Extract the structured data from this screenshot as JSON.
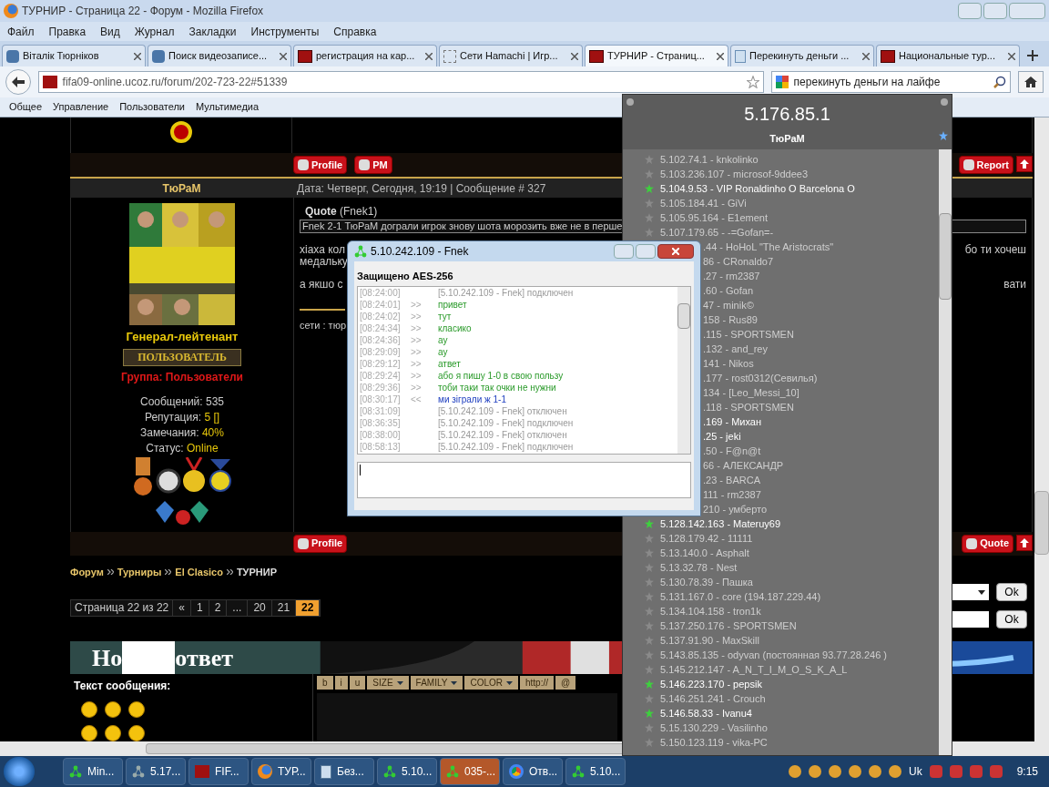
{
  "window": {
    "title": "ТУРНИР - Страница 22 - Форум - Mozilla Firefox"
  },
  "menu": [
    "Файл",
    "Правка",
    "Вид",
    "Журнал",
    "Закладки",
    "Инструменты",
    "Справка"
  ],
  "tabs": [
    {
      "label": "Віталік Тюрніков",
      "selected": false
    },
    {
      "label": "Поиск видеозаписе...",
      "selected": false
    },
    {
      "label": "регистрация на кар...",
      "selected": false
    },
    {
      "label": "Сети Hamachi | Игр...",
      "selected": false
    },
    {
      "label": "ТУРНИР - Страниц...",
      "selected": true
    },
    {
      "label": "Перекинуть деньги ...",
      "selected": false
    },
    {
      "label": "Национальные тур...",
      "selected": false
    }
  ],
  "address": {
    "value": "fifa09-online.ucoz.ru/forum/202-723-22#51339"
  },
  "search": {
    "value": "перекинуть деньги на лайфе"
  },
  "bookmarks": [
    "Общее",
    "Управление",
    "Пользователи",
    "Мультимедиа"
  ],
  "post": {
    "author": "ТюРаМ",
    "header": "Дата: Четверг, Сегодня, 19:19 | Сообщение # 327",
    "rank": "Генерал-лейтенант",
    "badge": "ПОЛЬЗОВАТЕЛЬ",
    "group": "Группа: Пользователи",
    "stats": [
      {
        "label": "Сообщений:",
        "value": "535",
        "kind": "plain"
      },
      {
        "label": "Репутация:",
        "value": "5 []",
        "kind": "gold"
      },
      {
        "label": "Замечания:",
        "value": "40%",
        "kind": "gold"
      },
      {
        "label": "Статус:",
        "value": "Online",
        "kind": "gold"
      }
    ],
    "quote_title": "Quote",
    "quote_author": "(Fnek1)",
    "quote_text": "Fnek 2-1 ТюРаМ дограли игрок знову шота морозить вже не в перше",
    "lines": [
      {
        "left": "хіаха кол",
        "right": "бо ти хочеш"
      },
      {
        "left": "медалькy"
      },
      {
        "left": "а якшо с",
        "right": "вати"
      }
    ],
    "signature": "сети : тюр",
    "buttons_top": [
      "Profile",
      "PM"
    ],
    "report": "Report",
    "buttons_bottom": [
      "Profile"
    ],
    "quote_button": "Quote"
  },
  "breadcrumbs": [
    "Форум",
    "Турниры",
    "El Clasico",
    "ТУРНИР"
  ],
  "pagination": {
    "label": "Страница 22 из 22",
    "pages": [
      {
        "label": "«",
        "selected": false
      },
      {
        "label": "1",
        "selected": false
      },
      {
        "label": "2",
        "selected": false
      },
      {
        "label": "...",
        "selected": false
      },
      {
        "label": "20",
        "selected": false
      },
      {
        "label": "21",
        "selected": false
      },
      {
        "label": "22",
        "selected": true
      }
    ]
  },
  "ok_buttons": [
    "Ok",
    "Ok"
  ],
  "reply": {
    "title_left": "Но",
    "title_right": "ответ",
    "text_label": "Текст сообщения:",
    "toolbar": [
      {
        "label": "b",
        "kind": "plain"
      },
      {
        "label": "i",
        "kind": "plain"
      },
      {
        "label": "u",
        "kind": "plain"
      },
      {
        "label": "SIZE",
        "kind": "menu"
      },
      {
        "label": "FAMILY",
        "kind": "menu"
      },
      {
        "label": "COLOR",
        "kind": "menu"
      },
      {
        "label": "http://",
        "kind": "plain"
      },
      {
        "label": "@",
        "kind": "plain"
      }
    ]
  },
  "hamachi": {
    "address": "5.176.85.1",
    "nick": "ТюРаМ",
    "peers": [
      {
        "text": "5.102.74.1 - knkolinko",
        "online": false,
        "kind": "full"
      },
      {
        "text": "5.103.236.107 - microsof-9ddee3",
        "online": false,
        "kind": "full"
      },
      {
        "text": "5.104.9.53 - VIP Ronaldinho O Barcelona O",
        "online": true,
        "kind": "full"
      },
      {
        "text": "5.105.184.41 - GiVi",
        "online": false,
        "kind": "full"
      },
      {
        "text": "5.105.95.164 - E1ement",
        "online": false,
        "kind": "full"
      },
      {
        "text": "5.107.179.65 - -=Gofan=-",
        "online": false,
        "kind": "full"
      },
      {
        "text": ".44 - HoHoL \"The Aristocrats\"",
        "online": false,
        "kind": "partial"
      },
      {
        "text": "86 - CRonaldo7",
        "online": false,
        "kind": "partial"
      },
      {
        "text": ".27 - rm2387",
        "online": false,
        "kind": "partial"
      },
      {
        "text": ".60 - Gofan",
        "online": false,
        "kind": "partial"
      },
      {
        "text": "47 - minik©",
        "online": false,
        "kind": "partial"
      },
      {
        "text": "158 - Rus89",
        "online": false,
        "kind": "partial"
      },
      {
        "text": ".115 - SPORTSMEN",
        "online": false,
        "kind": "partial"
      },
      {
        "text": ".132 - and_rey",
        "online": false,
        "kind": "partial"
      },
      {
        "text": "141 - Nikos",
        "online": false,
        "kind": "partial"
      },
      {
        "text": ".177 - rost0312(Севилья)",
        "online": false,
        "kind": "partial"
      },
      {
        "text": "134 - [Leo_Messi_10]",
        "online": false,
        "kind": "partial"
      },
      {
        "text": ".118 - SPORTSMEN",
        "online": false,
        "kind": "partial"
      },
      {
        "text": ".169 - Михан",
        "online": true,
        "kind": "partial"
      },
      {
        "text": ".25 - jeki",
        "online": true,
        "kind": "partial"
      },
      {
        "text": ".50 - F@n@t",
        "online": false,
        "kind": "partial"
      },
      {
        "text": "66 - АЛЕКСАНДР",
        "online": false,
        "kind": "partial"
      },
      {
        "text": ".23 - BARCA",
        "online": false,
        "kind": "partial"
      },
      {
        "text": "111 - rm2387",
        "online": false,
        "kind": "partial"
      },
      {
        "text": "210 - умберто",
        "online": false,
        "kind": "partial"
      },
      {
        "text": "5.128.142.163 - Materuy69",
        "online": true,
        "kind": "full"
      },
      {
        "text": "5.128.179.42 - 11111",
        "online": false,
        "kind": "full"
      },
      {
        "text": "5.13.140.0 - Asphalt",
        "online": false,
        "kind": "full"
      },
      {
        "text": "5.13.32.78 - Nest",
        "online": false,
        "kind": "full"
      },
      {
        "text": "5.130.78.39 - Пашка",
        "online": false,
        "kind": "full"
      },
      {
        "text": "5.131.167.0 - core (194.187.229.44)",
        "online": false,
        "kind": "full"
      },
      {
        "text": "5.134.104.158 - tron1k",
        "online": false,
        "kind": "full"
      },
      {
        "text": "5.137.250.176 - SPORTSMEN",
        "online": false,
        "kind": "full"
      },
      {
        "text": "5.137.91.90 - MaxSkill",
        "online": false,
        "kind": "full"
      },
      {
        "text": "5.143.85.135 - odyvan (постоянная 93.77.28.246 )",
        "online": false,
        "kind": "full"
      },
      {
        "text": "5.145.212.147 - A_N_T_I_M_O_S_K_A_L",
        "online": false,
        "kind": "full"
      },
      {
        "text": "5.146.223.170 - pepsik",
        "online": true,
        "kind": "full"
      },
      {
        "text": "5.146.251.241 - Crouch",
        "online": false,
        "kind": "full"
      },
      {
        "text": "5.146.58.33 - Ivanu4",
        "online": true,
        "kind": "full"
      },
      {
        "text": "5.15.130.229 - Vasilinho",
        "online": false,
        "kind": "full"
      },
      {
        "text": "5.150.123.119 - vika-PC",
        "online": false,
        "kind": "full"
      }
    ]
  },
  "chat": {
    "title": "5.10.242.109 - Fnek",
    "security": "Защищено AES-256",
    "messages": [
      {
        "time": "[08:24:00]",
        "text": "[5.10.242.109 - Fnek] подключен",
        "kind": "system"
      },
      {
        "time": "[08:24:01]",
        "dir": ">>",
        "text": "привет",
        "kind": "in"
      },
      {
        "time": "[08:24:02]",
        "dir": ">>",
        "text": "тут",
        "kind": "in"
      },
      {
        "time": "[08:24:34]",
        "dir": ">>",
        "text": "класико",
        "kind": "in"
      },
      {
        "time": "[08:24:36]",
        "dir": ">>",
        "text": "ау",
        "kind": "in"
      },
      {
        "time": "[08:29:09]",
        "dir": ">>",
        "text": "ау",
        "kind": "in"
      },
      {
        "time": "[08:29:12]",
        "dir": ">>",
        "text": "атвет",
        "kind": "in"
      },
      {
        "time": "[08:29:24]",
        "dir": ">>",
        "text": "або я пишу 1-0 в свою пользу",
        "kind": "in"
      },
      {
        "time": "[08:29:36]",
        "dir": ">>",
        "text": "тоби таки так очки не нужни",
        "kind": "in"
      },
      {
        "time": "[08:30:17]",
        "dir": "<<",
        "text": "ми зіграли ж 1-1",
        "kind": "out"
      },
      {
        "time": "[08:31:09]",
        "text": "[5.10.242.109 - Fnek] отключен",
        "kind": "system"
      },
      {
        "time": "[08:36:35]",
        "text": "[5.10.242.109 - Fnek] подключен",
        "kind": "system"
      },
      {
        "time": "[08:38:00]",
        "text": "[5.10.242.109 - Fnek] отключен",
        "kind": "system"
      },
      {
        "time": "[08:58:13]",
        "text": "[5.10.242.109 - Fnek] подключен",
        "kind": "system"
      }
    ]
  },
  "taskbar": {
    "items": [
      {
        "label": "Min...",
        "selected": false
      },
      {
        "label": "5.17...",
        "selected": false
      },
      {
        "label": "FIF...",
        "selected": false
      },
      {
        "label": "ТУР...",
        "selected": false
      },
      {
        "label": "Без...",
        "selected": false
      },
      {
        "label": "5.10...",
        "selected": false
      },
      {
        "label": "035-...",
        "selected": true
      },
      {
        "label": "Отв...",
        "selected": false
      },
      {
        "label": "5.10...",
        "selected": false
      }
    ],
    "language": "Uk",
    "clock": "9:15"
  }
}
